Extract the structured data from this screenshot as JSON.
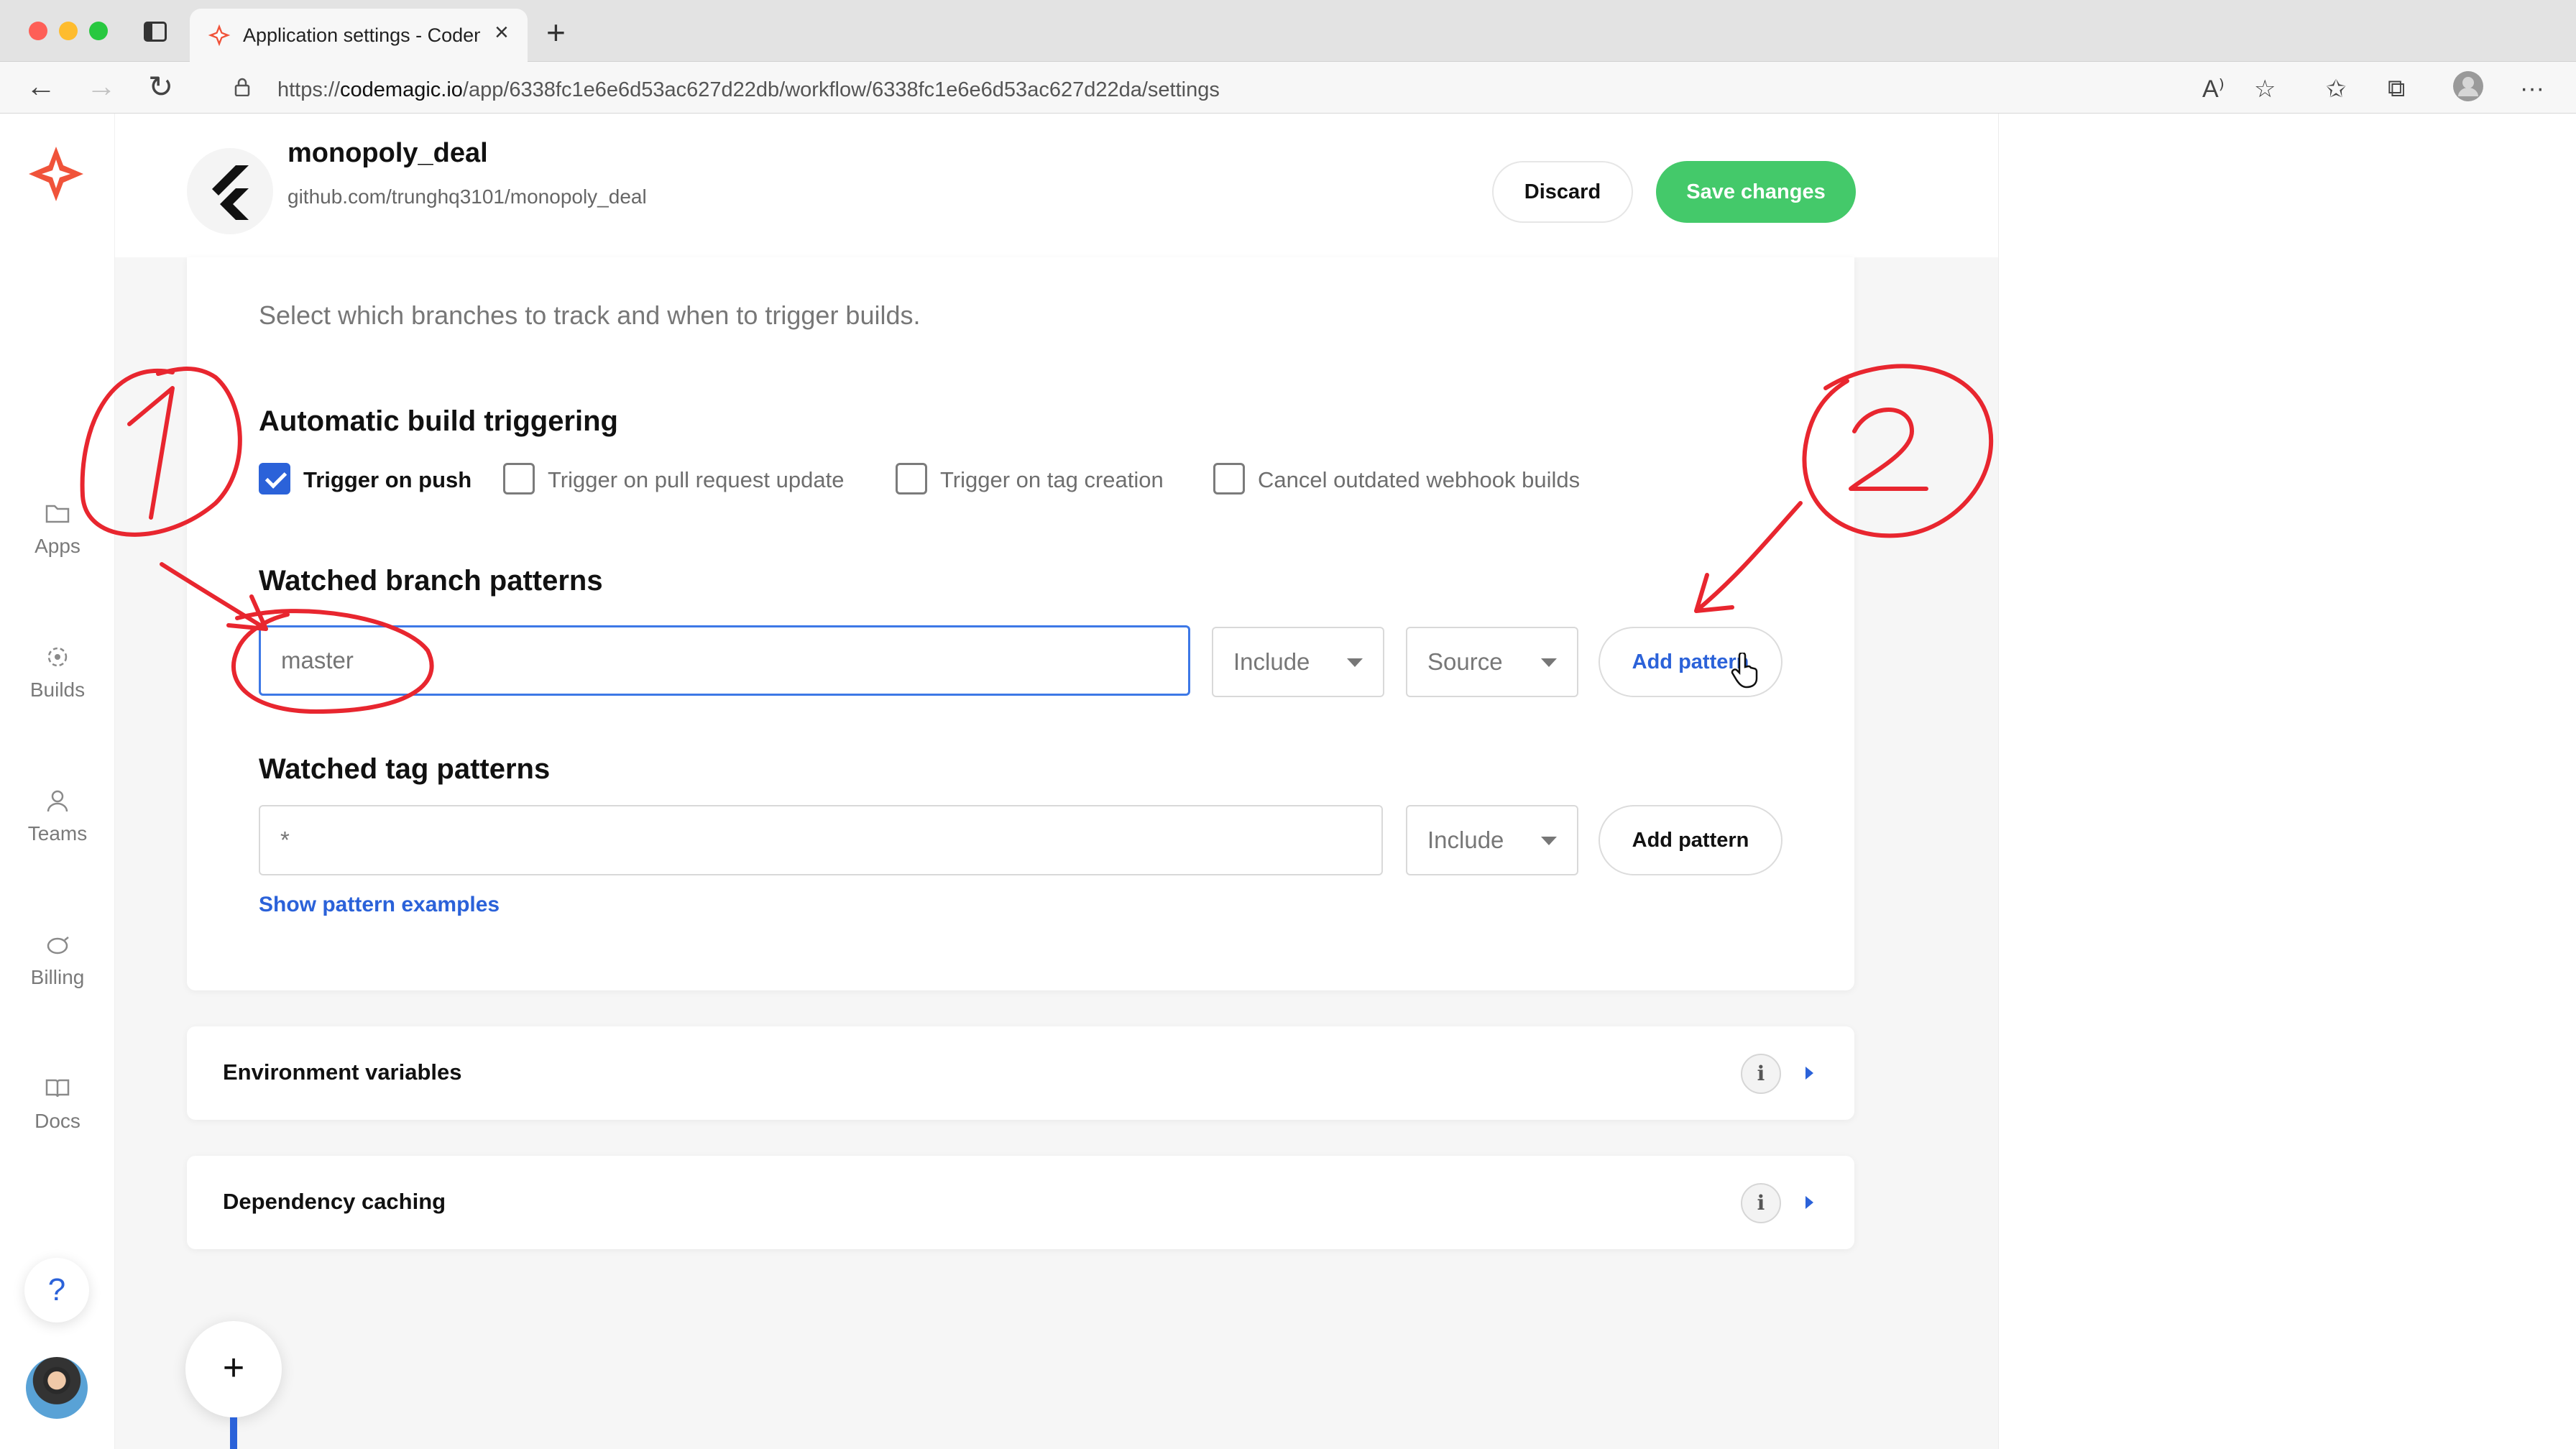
{
  "browser": {
    "tab_title": "Application settings - Codemagic",
    "url_prefix": "https://",
    "url_host": "codemagic.io",
    "url_path": "/app/6338fc1e6e6d53ac627d22db/workflow/6338fc1e6e6d53ac627d22da/settings"
  },
  "sidebar": {
    "items": [
      {
        "label": "Apps",
        "icon": "folder-icon"
      },
      {
        "label": "Builds",
        "icon": "builds-icon"
      },
      {
        "label": "Teams",
        "icon": "person-icon"
      },
      {
        "label": "Billing",
        "icon": "piggy-bank-icon"
      },
      {
        "label": "Docs",
        "icon": "book-icon"
      }
    ],
    "help_label": "?"
  },
  "header": {
    "app_name": "monopoly_deal",
    "repo": "github.com/trunghq3101/monopoly_deal",
    "discard_label": "Discard",
    "save_label": "Save changes"
  },
  "triggers": {
    "subtitle": "Select which branches to track and when to trigger builds.",
    "auto_title": "Automatic build triggering",
    "checkboxes": [
      {
        "label": "Trigger on push",
        "checked": true
      },
      {
        "label": "Trigger on pull request update",
        "checked": false
      },
      {
        "label": "Trigger on tag creation",
        "checked": false
      },
      {
        "label": "Cancel outdated webhook builds",
        "checked": false
      }
    ],
    "branch_title": "Watched branch patterns",
    "branch_placeholder": "master",
    "branch_include": "Include",
    "branch_source": "Source",
    "branch_add": "Add pattern",
    "tag_title": "Watched tag patterns",
    "tag_placeholder": "*",
    "tag_include": "Include",
    "tag_add": "Add pattern",
    "examples_link": "Show pattern examples"
  },
  "sections": [
    {
      "title": "Environment variables"
    },
    {
      "title": "Dependency caching"
    }
  ],
  "fab_label": "+",
  "colors": {
    "accent": "#2b62d9",
    "save": "#44c96a",
    "annotation": "#e8262f"
  }
}
